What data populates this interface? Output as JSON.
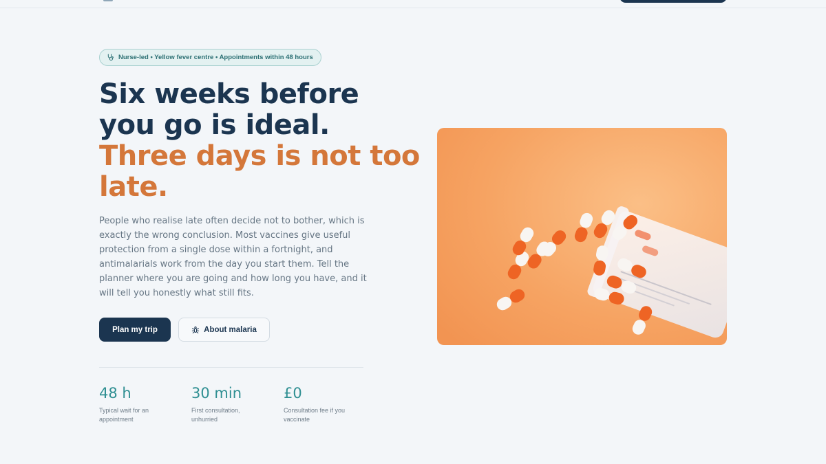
{
  "badge": {
    "icon": "stethoscope-icon",
    "text": "Nurse-led • Yellow fever centre • Appointments within 48 hours"
  },
  "hero": {
    "headline_line1": "Six weeks before",
    "headline_line2": "you go is ideal.",
    "headline_accent_line1": "Three days is not too",
    "headline_accent_line2": "late.",
    "lede": "People who realise late often decide not to bother, which is exactly the wrong conclusion. Most vaccines give useful protection from a single dose within a fortnight, and antimalarials work from the day you start them. Tell the planner where you are going and how long you have, and it will tell you honestly what still fits."
  },
  "actions": {
    "primary_label": "Plan my trip",
    "secondary_label": "About malaria",
    "secondary_icon": "mosquito-icon"
  },
  "stats": [
    {
      "value": "48 h",
      "label": "Typical wait for an appointment"
    },
    {
      "value": "30 min",
      "label": "First consultation, unhurried"
    },
    {
      "value": "£0",
      "label": "Consultation fee if you vaccinate"
    }
  ],
  "image": {
    "subject": "pills-spilling-from-bottle"
  },
  "colors": {
    "navy": "#1b3550",
    "accent_orange": "#d4773a",
    "teal": "#2f8f92",
    "background": "#f3f6f9",
    "badge_bg": "#e3f1f1",
    "image_orange": "#f6a362"
  }
}
